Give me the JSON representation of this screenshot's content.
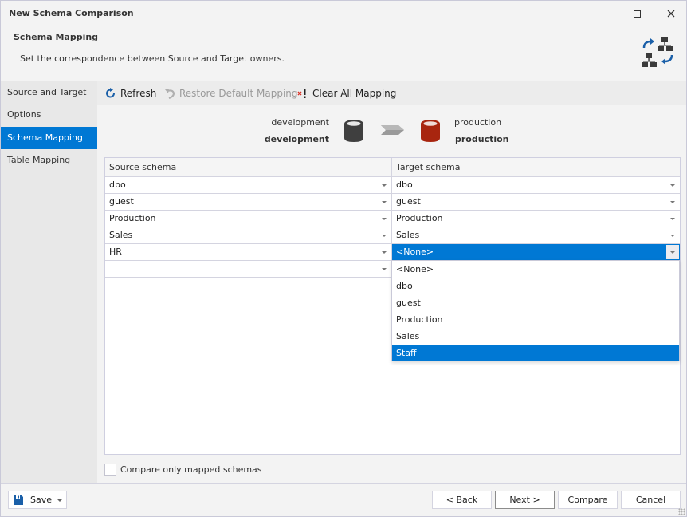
{
  "window": {
    "title": "New Schema Comparison"
  },
  "header": {
    "title": "Schema Mapping",
    "description": "Set the correspondence between Source and Target owners.",
    "icon": "schema-mapping-icon"
  },
  "sidebar": {
    "items": [
      {
        "label": "Source and Target",
        "active": false
      },
      {
        "label": "Options",
        "active": false
      },
      {
        "label": "Schema Mapping",
        "active": true
      },
      {
        "label": "Table Mapping",
        "active": false
      }
    ]
  },
  "toolbar": {
    "refresh_label": "Refresh",
    "restore_label": "Restore Default Mapping",
    "clear_label": "Clear All Mapping"
  },
  "connections": {
    "source": {
      "name": "development",
      "database": "development",
      "color": "#3f3f3f"
    },
    "target": {
      "name": "production",
      "database": "production",
      "color": "#a8250f"
    }
  },
  "grid": {
    "columns": [
      "Source schema",
      "Target schema"
    ],
    "rows": [
      {
        "source": "dbo",
        "target": "dbo"
      },
      {
        "source": "guest",
        "target": "guest"
      },
      {
        "source": "Production",
        "target": "Production"
      },
      {
        "source": "Sales",
        "target": "Sales"
      },
      {
        "source": "HR",
        "target": "<None>"
      },
      {
        "source": "",
        "target": ""
      }
    ]
  },
  "dropdown": {
    "options": [
      "<None>",
      "dbo",
      "guest",
      "Production",
      "Sales",
      "Staff"
    ],
    "highlighted": "Staff"
  },
  "options": {
    "compare_only_mapped_label": "Compare only mapped schemas",
    "compare_only_mapped_checked": false
  },
  "footer": {
    "save_label": "Save",
    "back_label": "< Back",
    "next_label": "Next >",
    "compare_label": "Compare",
    "cancel_label": "Cancel"
  },
  "colors": {
    "accent": "#0078d4"
  }
}
